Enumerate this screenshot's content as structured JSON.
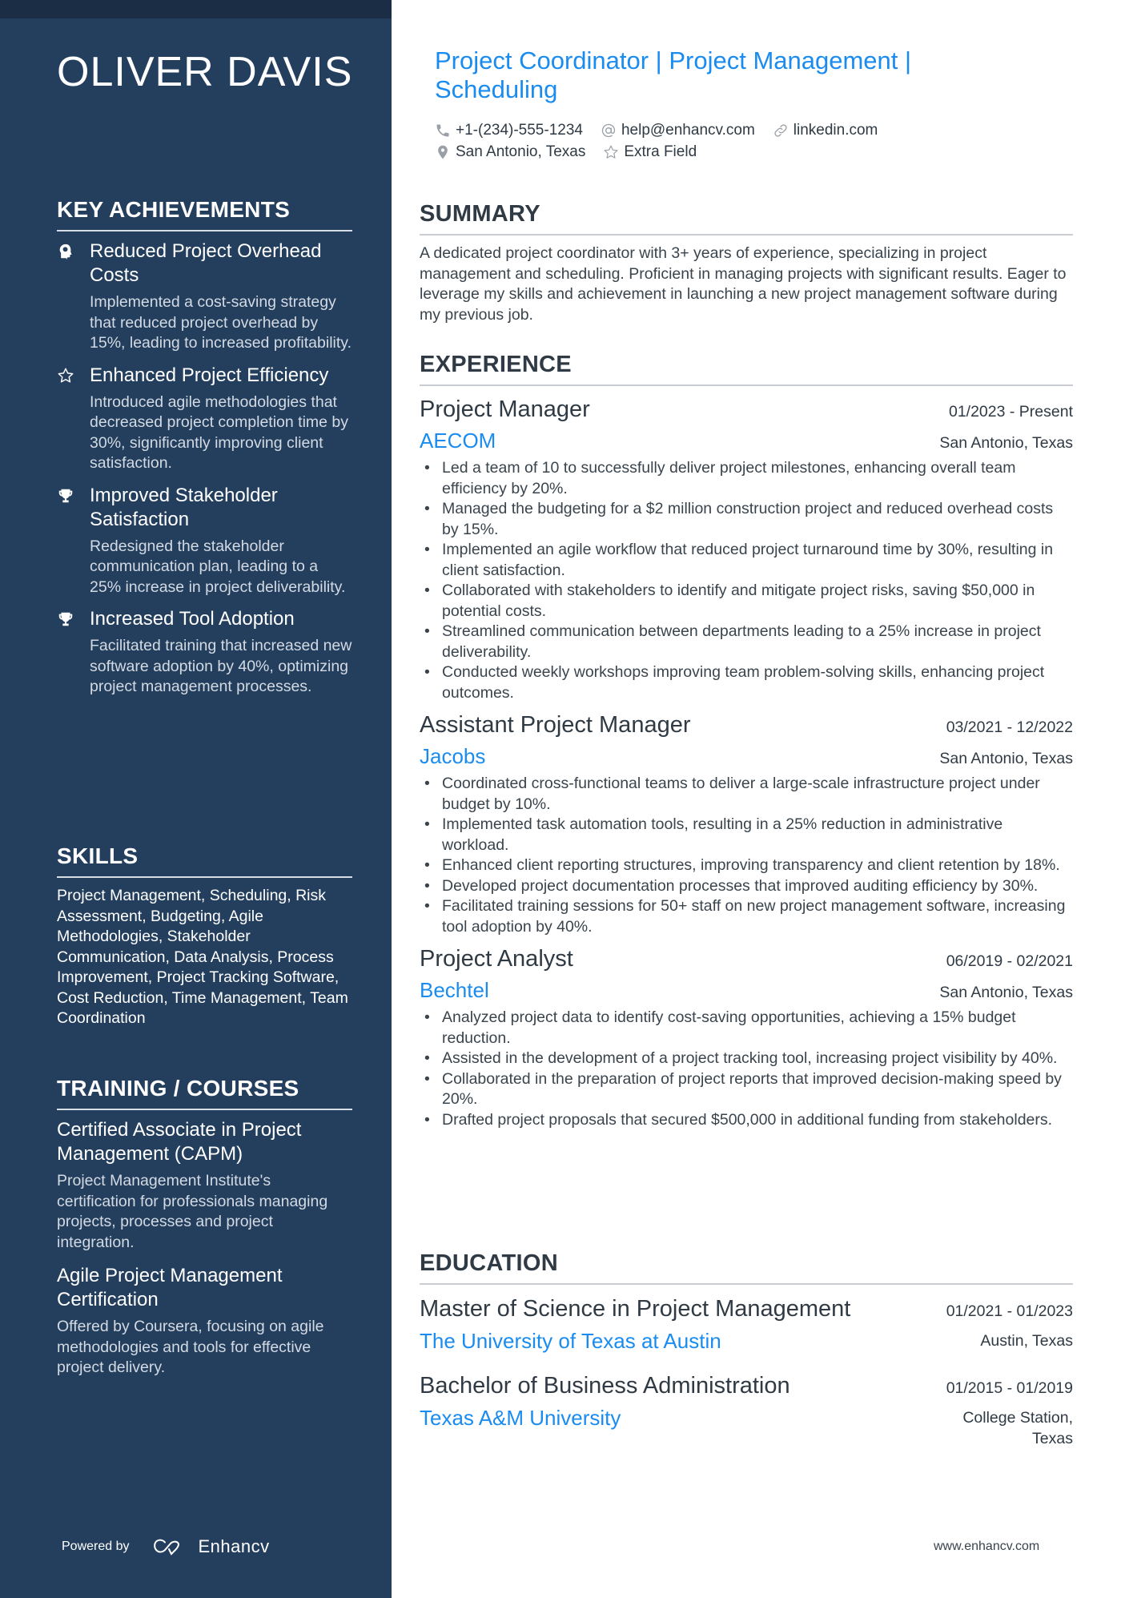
{
  "sidebar": {
    "name": "OLIVER DAVIS",
    "achievements": {
      "heading": "KEY ACHIEVEMENTS",
      "items": [
        {
          "icon": "head-brain-icon",
          "title": "Reduced Project Overhead Costs",
          "description": "Implemented a cost-saving strategy that reduced project overhead by 15%, leading to increased profitability."
        },
        {
          "icon": "star-icon",
          "title": "Enhanced Project Efficiency",
          "description": "Introduced agile methodologies that decreased project completion time by 30%, significantly improving client satisfaction."
        },
        {
          "icon": "trophy-icon",
          "title": "Improved Stakeholder Satisfaction",
          "description": "Redesigned the stakeholder communication plan, leading to a 25% increase in project deliverability."
        },
        {
          "icon": "trophy-icon",
          "title": "Increased Tool Adoption",
          "description": "Facilitated training that increased new software adoption by 40%, optimizing project management processes."
        }
      ]
    },
    "skills": {
      "heading": "SKILLS",
      "text": "Project Management, Scheduling, Risk Assessment, Budgeting, Agile Methodologies, Stakeholder Communication, Data Analysis, Process Improvement, Project Tracking Software, Cost Reduction, Time Management, Team Coordination"
    },
    "training": {
      "heading": "TRAINING / COURSES",
      "items": [
        {
          "title": "Certified Associate in Project Management (CAPM)",
          "description": "Project Management Institute's certification for professionals managing projects, processes and project integration."
        },
        {
          "title": "Agile Project Management Certification",
          "description": "Offered by Coursera, focusing on agile methodologies and tools for effective project delivery."
        }
      ]
    },
    "footer": {
      "powered_by": "Powered by",
      "brand": "Enhancv"
    }
  },
  "header": {
    "headline": "Project Coordinator | Project Management | Scheduling",
    "contacts": {
      "phone": "+1-(234)-555-1234",
      "email": "help@enhancv.com",
      "link": "linkedin.com",
      "location": "San Antonio, Texas",
      "extra": "Extra Field"
    }
  },
  "summary": {
    "heading": "SUMMARY",
    "text": "A dedicated project coordinator with 3+ years of experience, specializing in project management and scheduling. Proficient in managing projects with significant results. Eager to leverage my skills and achievement in launching a new project management software during my previous job."
  },
  "experience": {
    "heading": "EXPERIENCE",
    "jobs": [
      {
        "title": "Project Manager",
        "dates": "01/2023 - Present",
        "company": "AECOM",
        "location": "San Antonio, Texas",
        "bullets": [
          "Led a team of 10 to successfully deliver project milestones, enhancing overall team efficiency by 20%.",
          "Managed the budgeting for a $2 million construction project and reduced overhead costs by 15%.",
          "Implemented an agile workflow that reduced project turnaround time by 30%, resulting in client satisfaction.",
          "Collaborated with stakeholders to identify and mitigate project risks, saving $50,000 in potential costs.",
          "Streamlined communication between departments leading to a 25% increase in project deliverability.",
          "Conducted weekly workshops improving team problem-solving skills, enhancing project outcomes."
        ]
      },
      {
        "title": "Assistant Project Manager",
        "dates": "03/2021 - 12/2022",
        "company": "Jacobs",
        "location": "San Antonio, Texas",
        "bullets": [
          "Coordinated cross-functional teams to deliver a large-scale infrastructure project under budget by 10%.",
          "Implemented task automation tools, resulting in a 25% reduction in administrative workload.",
          "Enhanced client reporting structures, improving transparency and client retention by 18%.",
          "Developed project documentation processes that improved auditing efficiency by 30%.",
          "Facilitated training sessions for 50+ staff on new project management software, increasing tool adoption by 40%."
        ]
      },
      {
        "title": "Project Analyst",
        "dates": "06/2019 - 02/2021",
        "company": "Bechtel",
        "location": "San Antonio, Texas",
        "bullets": [
          "Analyzed project data to identify cost-saving opportunities, achieving a 15% budget reduction.",
          "Assisted in the development of a project tracking tool, increasing project visibility by 40%.",
          "Collaborated in the preparation of project reports that improved decision-making speed by 20%.",
          "Drafted project proposals that secured $500,000 in additional funding from stakeholders."
        ]
      }
    ]
  },
  "education": {
    "heading": "EDUCATION",
    "items": [
      {
        "degree": "Master of Science in Project Management",
        "dates": "01/2021 - 01/2023",
        "school": "The University of Texas at Austin",
        "location": "Austin, Texas"
      },
      {
        "degree": "Bachelor of Business Administration",
        "dates": "01/2015 - 01/2019",
        "school": "Texas A&M University",
        "location": "College Station, Texas"
      }
    ]
  },
  "footer": {
    "website": "www.enhancv.com"
  },
  "colors": {
    "sidebar": "#243f5d",
    "accent": "#1a8cf0",
    "text": "#2f3a44"
  }
}
